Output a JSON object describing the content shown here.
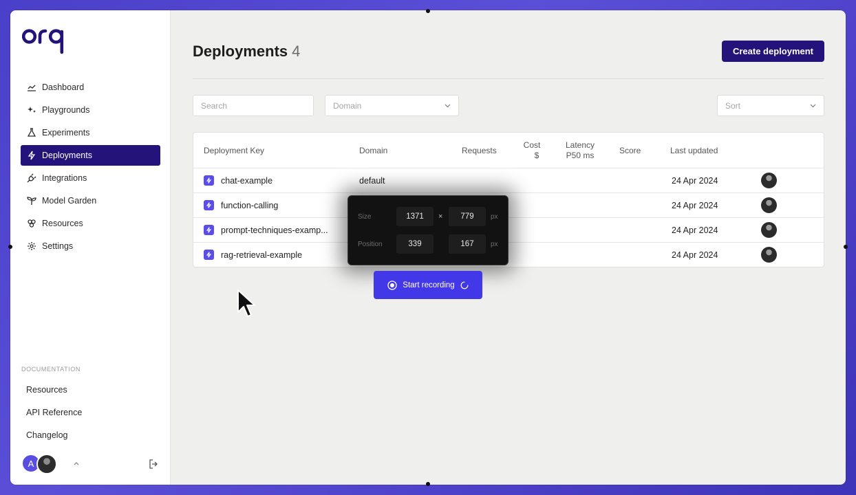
{
  "brand": {
    "logo_text": "orq",
    "accent": "#23137a",
    "badge_color": "#5b4ee6"
  },
  "sidebar": {
    "items": [
      {
        "label": "Dashboard",
        "icon": "chart-line-icon",
        "active": false
      },
      {
        "label": "Playgrounds",
        "icon": "sparkles-icon",
        "active": false
      },
      {
        "label": "Experiments",
        "icon": "flask-icon",
        "active": false
      },
      {
        "label": "Deployments",
        "icon": "bolt-icon",
        "active": true
      },
      {
        "label": "Integrations",
        "icon": "plug-icon",
        "active": false
      },
      {
        "label": "Model Garden",
        "icon": "sprout-icon",
        "active": false
      },
      {
        "label": "Resources",
        "icon": "nodes-icon",
        "active": false
      },
      {
        "label": "Settings",
        "icon": "gear-icon",
        "active": false
      }
    ],
    "documentation_heading": "DOCUMENTATION",
    "docs": [
      "Resources",
      "API Reference",
      "Changelog"
    ],
    "user_initial": "A"
  },
  "page": {
    "title": "Deployments",
    "count": "4",
    "create_button": "Create deployment"
  },
  "filters": {
    "search_placeholder": "Search",
    "domain_placeholder": "Domain",
    "sort_placeholder": "Sort"
  },
  "table": {
    "headers": {
      "key": "Deployment Key",
      "domain": "Domain",
      "requests": "Requests",
      "cost_line1": "Cost",
      "cost_line2": "$",
      "latency_line1": "Latency",
      "latency_line2": "P50 ms",
      "score": "Score",
      "updated": "Last updated"
    },
    "rows": [
      {
        "key": "chat-example",
        "domain": "default",
        "updated": "24 Apr 2024"
      },
      {
        "key": "function-calling",
        "domain": "",
        "updated": "24 Apr 2024"
      },
      {
        "key": "prompt-techniques-examp...",
        "domain": "",
        "updated": "24 Apr 2024"
      },
      {
        "key": "rag-retrieval-example",
        "domain": "",
        "updated": "24 Apr 2024"
      }
    ]
  },
  "recorder": {
    "size_label": "Size",
    "width": "1371",
    "height": "779",
    "times": "×",
    "unit": "px",
    "position_label": "Position",
    "pos_x": "339",
    "pos_y": "167",
    "start_button": "Start recording"
  }
}
